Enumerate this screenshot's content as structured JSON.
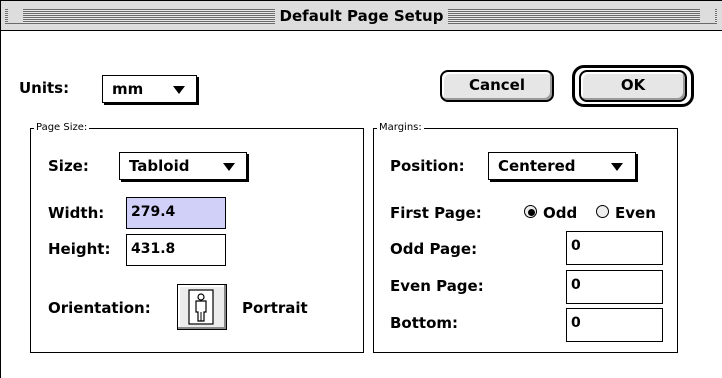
{
  "window": {
    "title": "Default Page Setup"
  },
  "units": {
    "label": "Units:",
    "value": "mm"
  },
  "buttons": {
    "cancel": "Cancel",
    "ok": "OK"
  },
  "page_size": {
    "group_label": "Page Size:",
    "size_label": "Size:",
    "size_value": "Tabloid",
    "width_label": "Width:",
    "width_value": "279.4",
    "height_label": "Height:",
    "height_value": "431.8",
    "orientation_label": "Orientation:",
    "orientation_value": "Portrait",
    "orientation_icon": "portrait-person-icon"
  },
  "margins": {
    "group_label": "Margins:",
    "position_label": "Position:",
    "position_value": "Centered",
    "first_page_label": "First Page:",
    "first_page_options": [
      "Odd",
      "Even"
    ],
    "first_page_selected": "Odd",
    "odd_page_label": "Odd Page:",
    "odd_page_value": "0",
    "even_page_label": "Even Page:",
    "even_page_value": "0",
    "bottom_label": "Bottom:",
    "bottom_value": "0"
  }
}
